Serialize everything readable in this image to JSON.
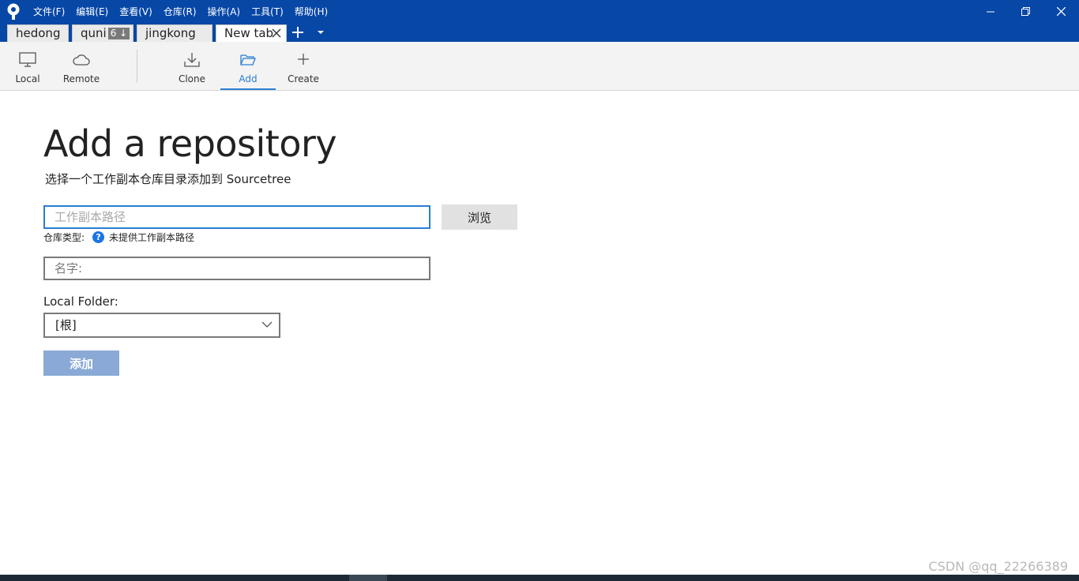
{
  "menu": [
    "文件(F)",
    "编辑(E)",
    "查看(V)",
    "仓库(R)",
    "操作(A)",
    "工具(T)",
    "帮助(H)"
  ],
  "tabs": [
    {
      "label": "hedong"
    },
    {
      "label": "quni",
      "badge": "6 ↓"
    },
    {
      "label": "jingkong"
    },
    {
      "label": "New tab"
    }
  ],
  "toolbar": {
    "local": "Local",
    "remote": "Remote",
    "clone": "Clone",
    "add": "Add",
    "create": "Create"
  },
  "main": {
    "title": "Add a repository",
    "subtitle": "选择一个工作副本仓库目录添加到 Sourcetree",
    "path_placeholder": "工作副本路径",
    "browse_label": "浏览",
    "repo_type_label": "仓库类型:",
    "repo_type_status": "未提供工作副本路径",
    "name_placeholder": "名字:",
    "folder_label": "Local Folder:",
    "folder_value": "[根]",
    "add_label": "添加"
  },
  "watermark": "CSDN @qq_22266389",
  "colors": {
    "titlebar": "#0747a6",
    "accent": "#2a7dd2",
    "add_button": "#8aa9d6"
  }
}
